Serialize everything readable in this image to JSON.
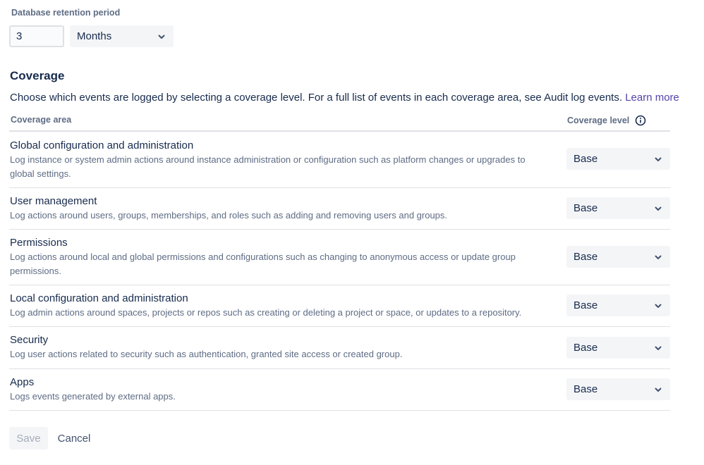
{
  "retention": {
    "label": "Database retention period",
    "value": "3",
    "unit": "Months"
  },
  "coverage": {
    "title": "Coverage",
    "description": "Choose which events are logged by selecting a coverage level. For a full list of events in each coverage area, see Audit log events.",
    "learn_more": "Learn more",
    "col_area": "Coverage area",
    "col_level": "Coverage level",
    "rows": [
      {
        "title": "Global configuration and administration",
        "desc": "Log instance or system admin actions around instance administration or configuration such as platform changes or upgrades to global settings.",
        "level": "Base"
      },
      {
        "title": "User management",
        "desc": "Log actions around users, groups, memberships, and roles such as adding and removing users and groups.",
        "level": "Base"
      },
      {
        "title": "Permissions",
        "desc": "Log actions around local and global permissions and configurations such as changing to anonymous access or update group permissions.",
        "level": "Base"
      },
      {
        "title": "Local configuration and administration",
        "desc": "Log admin actions around spaces, projects or repos such as creating or deleting a project or space, or updates to a repository.",
        "level": "Base"
      },
      {
        "title": "Security",
        "desc": "Log user actions related to security such as authentication, granted site access or created group.",
        "level": "Base"
      },
      {
        "title": "Apps",
        "desc": "Logs events generated by external apps.",
        "level": "Base"
      }
    ]
  },
  "actions": {
    "save": "Save",
    "cancel": "Cancel"
  },
  "icons": {
    "dropdown": "chevron-down-icon",
    "info": "info-icon"
  },
  "colors": {
    "text": "#172B4D",
    "subtle": "#5E6C84",
    "link": "#5243AA",
    "select_bg": "#F4F5F7",
    "divider": "#DFE1E6"
  }
}
